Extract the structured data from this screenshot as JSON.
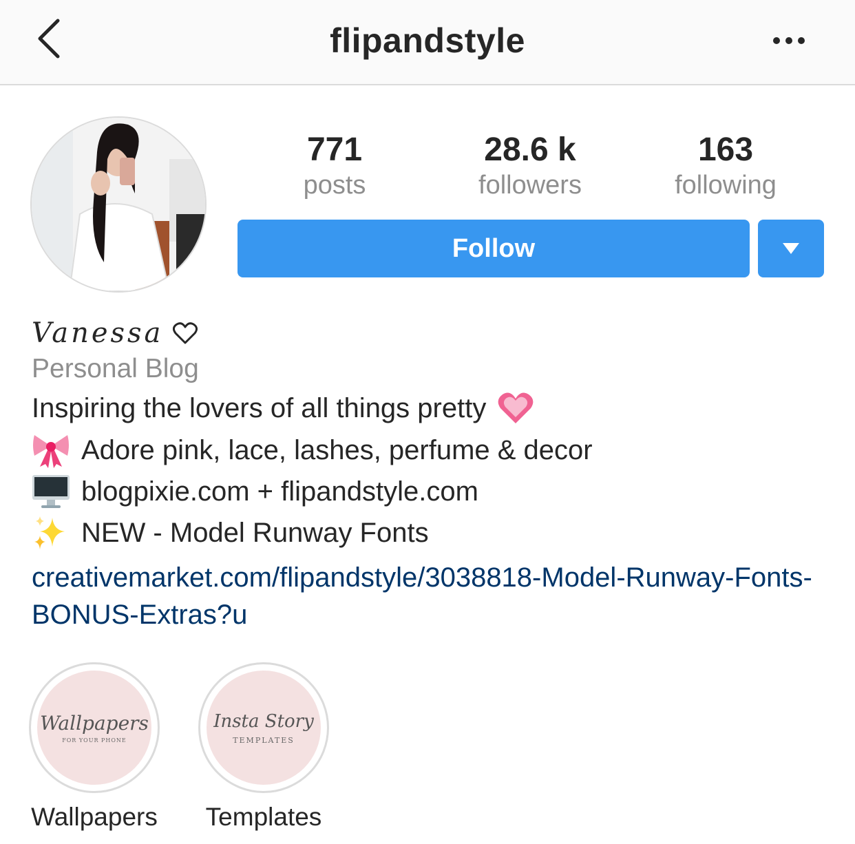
{
  "header": {
    "username": "flipandstyle",
    "back_icon": "chevron-left-icon",
    "more_icon": "more-horizontal-icon"
  },
  "stats": [
    {
      "value": "771",
      "label": "posts"
    },
    {
      "value": "28.6 k",
      "label": "followers"
    },
    {
      "value": "163",
      "label": "following"
    }
  ],
  "actions": {
    "follow_label": "Follow",
    "dropdown_icon": "caret-down-icon",
    "accent_color": "#3897f0"
  },
  "profile": {
    "display_name": "Vanessa",
    "name_icon": "heart-outline-icon",
    "category": "Personal Blog",
    "bio": [
      {
        "icon": "",
        "text": "Inspiring the lovers of all things pretty",
        "trailing_icon": "pink-heart-icon"
      },
      {
        "icon": "ribbon-icon",
        "text": "Adore pink, lace, lashes, perfume & decor"
      },
      {
        "icon": "desktop-computer-icon",
        "text": "blogpixie.com + flipandstyle.com"
      },
      {
        "icon": "sparkles-icon",
        "text": "NEW - Model Runway Fonts"
      }
    ],
    "link": "creativemarket.com/flipandstyle/3038818-Model-Runway-Fonts-BONUS-Extras?u",
    "link_color": "#003569"
  },
  "highlights": [
    {
      "label": "Wallpapers",
      "cover_text": "Wallpapers",
      "cover_subtext": "FOR YOUR PHONE"
    },
    {
      "label": "Templates",
      "cover_text": "Insta Story",
      "cover_subtext": "TEMPLATES"
    }
  ]
}
